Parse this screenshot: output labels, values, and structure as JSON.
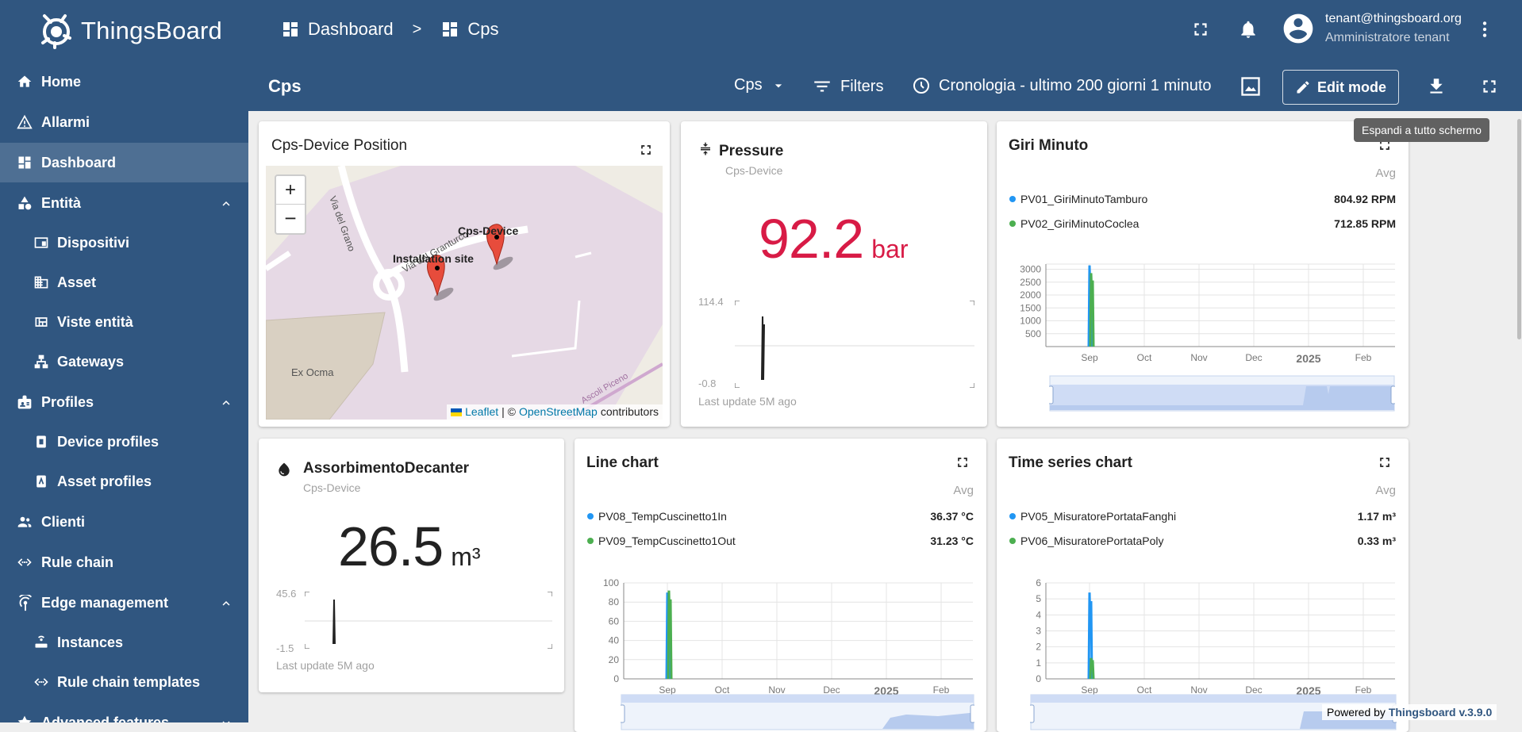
{
  "app": {
    "name": "ThingsBoard"
  },
  "breadcrumb": {
    "items": [
      "Dashboard",
      "Cps"
    ],
    "separator": ">"
  },
  "user": {
    "email": "tenant@thingsboard.org",
    "role": "Amministratore tenant"
  },
  "sidebar": {
    "items": [
      {
        "label": "Home",
        "icon": "home-icon"
      },
      {
        "label": "Allarmi",
        "icon": "warning-icon"
      },
      {
        "label": "Dashboard",
        "icon": "dashboard-icon",
        "selected": true
      },
      {
        "label": "Entità",
        "icon": "entity-icon",
        "expanded": true
      },
      {
        "label": "Dispositivi",
        "icon": "devices-icon"
      },
      {
        "label": "Asset",
        "icon": "asset-icon"
      },
      {
        "label": "Viste entità",
        "icon": "entity-view-icon"
      },
      {
        "label": "Gateways",
        "icon": "gateway-icon"
      },
      {
        "label": "Profiles",
        "icon": "profiles-icon",
        "expanded": true
      },
      {
        "label": "Device profiles",
        "icon": "device-profile-icon"
      },
      {
        "label": "Asset profiles",
        "icon": "asset-profile-icon"
      },
      {
        "label": "Clienti",
        "icon": "customers-icon"
      },
      {
        "label": "Rule chain",
        "icon": "rule-chain-icon"
      },
      {
        "label": "Edge management",
        "icon": "edge-icon",
        "expanded": true
      },
      {
        "label": "Instances",
        "icon": "instances-icon"
      },
      {
        "label": "Rule chain templates",
        "icon": "rule-chain-templates-icon"
      },
      {
        "label": "Advanced features",
        "icon": "advanced-icon"
      }
    ]
  },
  "dashboard": {
    "title": "Cps",
    "state_select": "Cps",
    "filters_label": "Filters",
    "timewindow": "Cronologia - ultimo 200 giorni 1 minuto",
    "edit_label": "Edit mode",
    "tooltip": "Espandi a tutto schermo"
  },
  "widgets": {
    "map": {
      "title": "Cps-Device Position",
      "labels": {
        "device": "Cps-Device",
        "site": "Installation site"
      },
      "streets": [
        "Via del Grano",
        "Via del Granturco",
        "Ex Ocma",
        "Ascoli Piceno"
      ],
      "attribution_leaflet": "Leaflet",
      "attribution_sep": "| ©",
      "attribution_osm": "OpenStreetMap",
      "attribution_tail": "contributors"
    },
    "pressure": {
      "title": "Pressure",
      "subtitle": "Cps-Device",
      "value": "92.2",
      "unit": "bar",
      "color": "#d81b46",
      "range_max": "114.4",
      "range_min": "-0.8",
      "last_update": "Last update 5M ago"
    },
    "giri": {
      "title": "Giri Minuto",
      "agg": "Avg",
      "legend": [
        {
          "name": "PV01_GiriMinutoTamburo",
          "value": "804.92 RPM",
          "color": "#2196f3"
        },
        {
          "name": "PV02_GiriMinutoCoclea",
          "value": "712.85 RPM",
          "color": "#4caf50"
        }
      ]
    },
    "assorbimento": {
      "title": "AssorbimentoDecanter",
      "subtitle": "Cps-Device",
      "value": "26.5",
      "unit": "m³",
      "range_max": "45.6",
      "range_min": "-1.5",
      "last_update": "Last update 5M ago"
    },
    "linechart": {
      "title": "Line chart",
      "agg": "Avg",
      "legend": [
        {
          "name": "PV08_TempCuscinetto1In",
          "value": "36.37 °C",
          "color": "#2196f3"
        },
        {
          "name": "PV09_TempCuscinetto1Out",
          "value": "31.23 °C",
          "color": "#4caf50"
        }
      ]
    },
    "timeseries": {
      "title": "Time series chart",
      "agg": "Avg",
      "legend": [
        {
          "name": "PV05_MisuratorePortataFanghi",
          "value": "1.17 m³",
          "color": "#2196f3"
        },
        {
          "name": "PV06_MisuratorePortataPoly",
          "value": "0.33 m³",
          "color": "#4caf50"
        }
      ]
    }
  },
  "footer": {
    "powered_by": "Powered by",
    "link": "Thingsboard v.3.9.0"
  },
  "chart_data": [
    {
      "type": "line",
      "title": "Giri Minuto",
      "x": [
        "Sep",
        "Oct",
        "Nov",
        "Dec",
        "2025",
        "Feb"
      ],
      "ylim": [
        0,
        3200
      ],
      "yticks": [
        "3000",
        "2500",
        "2000",
        "1500",
        "1000",
        "500"
      ],
      "series": [
        {
          "name": "PV01_GiriMinutoTamburo",
          "color": "#2196f3",
          "spike_month": 0,
          "peak": 3150
        },
        {
          "name": "PV02_GiriMinutoCoclea",
          "color": "#4caf50",
          "spike_month": 0,
          "peak": 2850
        }
      ]
    },
    {
      "type": "line",
      "title": "Line chart",
      "x": [
        "Sep",
        "Oct",
        "Nov",
        "Dec",
        "2025",
        "Feb"
      ],
      "ylim": [
        0,
        100
      ],
      "yticks": [
        "100",
        "80",
        "60",
        "40",
        "20",
        "0"
      ],
      "series": [
        {
          "name": "PV08_TempCuscinetto1In",
          "color": "#2196f3",
          "spike_month": 0,
          "peak": 90
        },
        {
          "name": "PV09_TempCuscinetto1Out",
          "color": "#4caf50",
          "spike_month": 0,
          "peak": 92
        }
      ]
    },
    {
      "type": "line",
      "title": "Time series chart",
      "x": [
        "Sep",
        "Oct",
        "Nov",
        "Dec",
        "2025",
        "Feb"
      ],
      "ylim": [
        0,
        6
      ],
      "yticks": [
        "6",
        "5",
        "4",
        "3",
        "2",
        "1",
        "0"
      ],
      "series": [
        {
          "name": "PV05_MisuratorePortataFanghi",
          "color": "#2196f3",
          "spike_month": 0,
          "peak": 5.4
        },
        {
          "name": "PV06_MisuratorePortataPoly",
          "color": "#4caf50",
          "spike_month": 0,
          "peak": 1.3
        }
      ]
    }
  ]
}
